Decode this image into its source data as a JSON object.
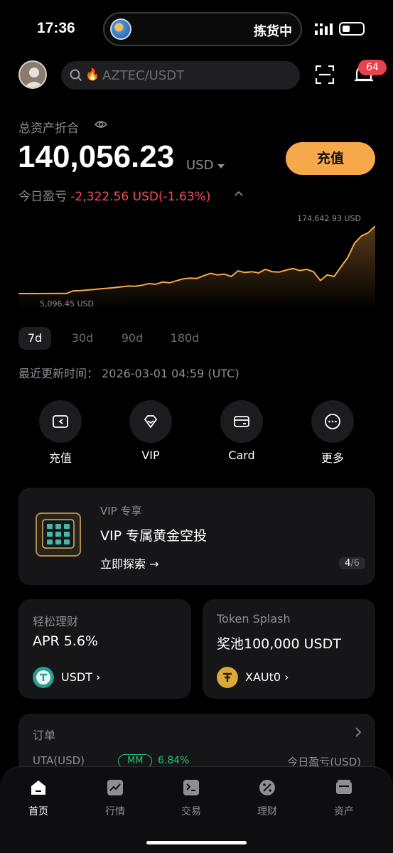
{
  "status_bar": {
    "time": "17:36",
    "island_text": "拣货中"
  },
  "header": {
    "search_text": "AZTEC/USDT",
    "notification_count": "64"
  },
  "assets": {
    "label": "总资产折合",
    "total": "140,056.23",
    "unit": "USD",
    "deposit_button": "充值",
    "pnl_label": "今日盈亏",
    "pnl_value": "-2,322.56 USD(-1.63%)"
  },
  "chart_data": {
    "type": "area",
    "max_label": "174,642.93 USD",
    "min_label": "5,096.45 USD",
    "color": "#f7a84a",
    "values": [
      5096,
      5096,
      5200,
      5150,
      5300,
      5250,
      5400,
      5350,
      12000,
      12500,
      14000,
      15500,
      17000,
      18500,
      20000,
      22000,
      24000,
      23500,
      26000,
      30000,
      28500,
      34000,
      32000,
      37000,
      42000,
      44000,
      43000,
      50000,
      56000,
      52000,
      54000,
      48000,
      62000,
      58000,
      60000,
      57000,
      66000,
      60000,
      59000,
      64000,
      68000,
      63000,
      66000,
      60000,
      38000,
      52000,
      48000,
      72000,
      96000,
      132000,
      150000,
      158000,
      174642
    ]
  },
  "ranges": [
    "7d",
    "30d",
    "90d",
    "180d"
  ],
  "updated": "最近更新时间：  2026-03-01 04:59 (UTC)",
  "quick_actions": [
    {
      "label": "充值",
      "icon": "wallet-in-icon"
    },
    {
      "label": "VIP",
      "icon": "vip-diamond-icon"
    },
    {
      "label": "Card",
      "icon": "card-icon"
    },
    {
      "label": "更多",
      "icon": "more-icon"
    }
  ],
  "vip_banner": {
    "tag": "VIP 专享",
    "title": "VIP 专属黄金空投",
    "link": "立即探索 →",
    "page_current": "4",
    "page_total": "/6"
  },
  "earn_card": {
    "label": "轻松理财",
    "value": "APR 5.6%",
    "coin": "USDT ›"
  },
  "splash_card": {
    "label": "Token Splash",
    "value": "奖池100,000 USDT",
    "coin": "XAUt0 ›"
  },
  "orders": {
    "title": "订单",
    "account": "UTA(USD)",
    "mm_label": "MM",
    "mm_value": "6.84%",
    "today_pnl_label": "今日盈亏(USD)"
  },
  "tabs": [
    {
      "label": "首页",
      "active": true
    },
    {
      "label": "行情",
      "active": false
    },
    {
      "label": "交易",
      "active": false
    },
    {
      "label": "理财",
      "active": false
    },
    {
      "label": "资产",
      "active": false
    }
  ]
}
